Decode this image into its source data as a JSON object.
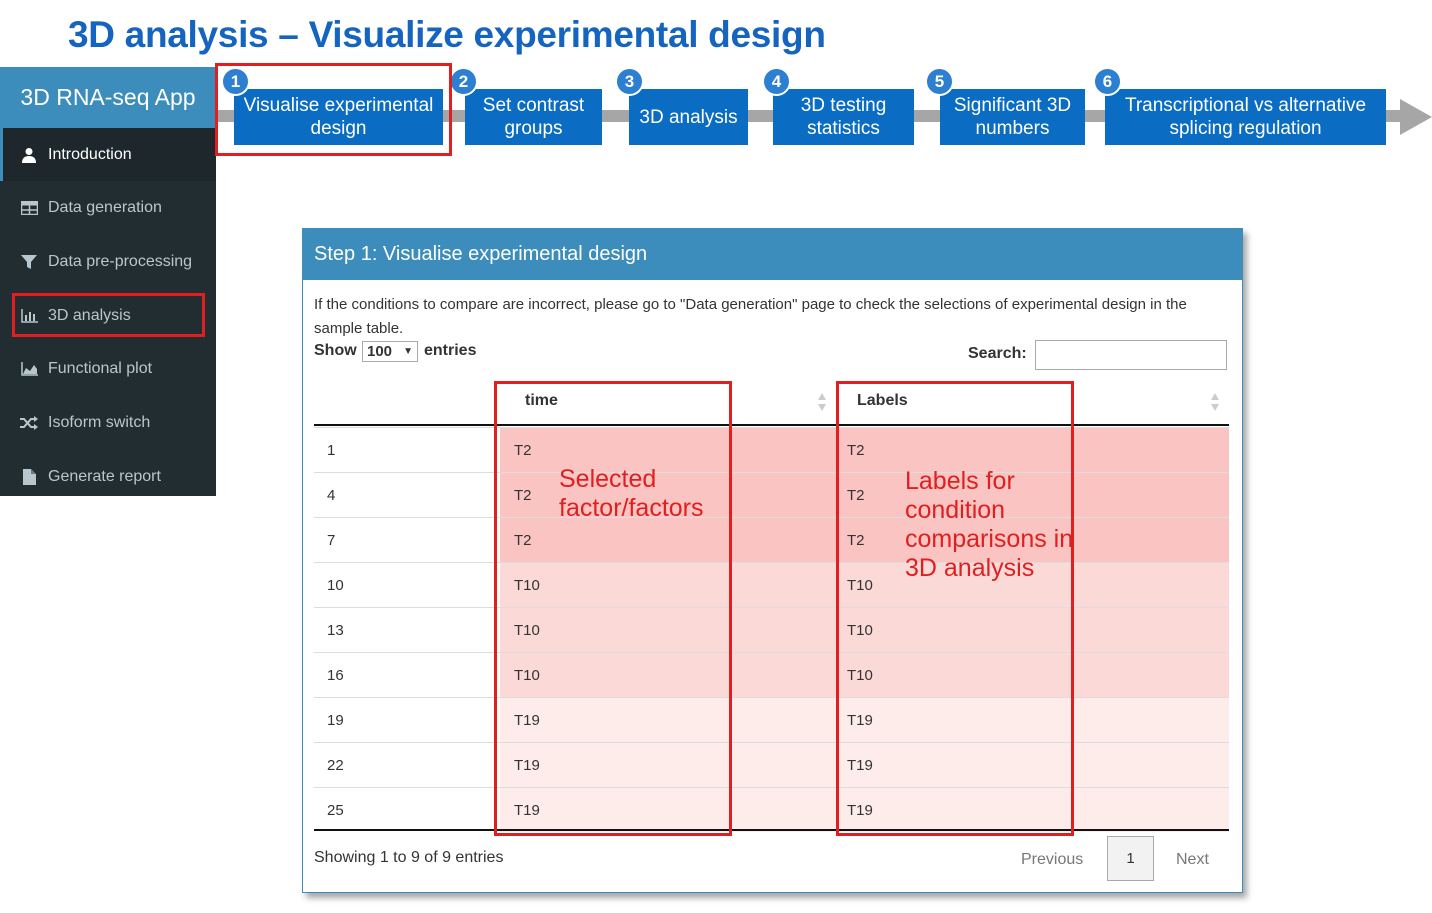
{
  "slide_title": "3D analysis – Visualize experimental design",
  "app": {
    "title": "3D RNA-seq App"
  },
  "sidebar": {
    "items": [
      {
        "label": "Introduction",
        "icon": "user-icon"
      },
      {
        "label": "Data generation",
        "icon": "table-icon"
      },
      {
        "label": "Data pre-processing",
        "icon": "filter-icon"
      },
      {
        "label": "3D analysis",
        "icon": "bar-chart-icon"
      },
      {
        "label": "Functional plot",
        "icon": "area-chart-icon"
      },
      {
        "label": "Isoform switch",
        "icon": "random-icon"
      },
      {
        "label": "Generate report",
        "icon": "file-icon"
      }
    ]
  },
  "steps": [
    {
      "num": "1",
      "label": "Visualise experimental design"
    },
    {
      "num": "2",
      "label": "Set contrast groups"
    },
    {
      "num": "3",
      "label": "3D analysis"
    },
    {
      "num": "4",
      "label": "3D testing statistics"
    },
    {
      "num": "5",
      "label": "Significant 3D numbers"
    },
    {
      "num": "6",
      "label": "Transcriptional vs alternative splicing regulation"
    }
  ],
  "panel": {
    "title": "Step 1: Visualise experimental design",
    "note": "If the conditions to compare are incorrect, please go to \"Data generation\" page to check the selections of experimental design in the sample table.",
    "show_label": "Show",
    "show_value": "100",
    "entries_label": "entries",
    "search_label": "Search:",
    "search_value": ""
  },
  "table": {
    "columns": [
      "",
      "time",
      "Labels"
    ],
    "rows": [
      {
        "id": "1",
        "time": "T2",
        "label": "T2"
      },
      {
        "id": "4",
        "time": "T2",
        "label": "T2"
      },
      {
        "id": "7",
        "time": "T2",
        "label": "T2"
      },
      {
        "id": "10",
        "time": "T10",
        "label": "T10"
      },
      {
        "id": "13",
        "time": "T10",
        "label": "T10"
      },
      {
        "id": "16",
        "time": "T10",
        "label": "T10"
      },
      {
        "id": "19",
        "time": "T19",
        "label": "T19"
      },
      {
        "id": "22",
        "time": "T19",
        "label": "T19"
      },
      {
        "id": "25",
        "time": "T19",
        "label": "T19"
      }
    ],
    "group_colors": {
      "T2": "#f9c4c1",
      "T10": "#fbd9d7",
      "T19": "#fdecea"
    }
  },
  "footer": {
    "info": "Showing 1 to 9 of 9 entries",
    "previous": "Previous",
    "page": "1",
    "next": "Next"
  },
  "annotations": {
    "selected_factors": "Selected factor/factors",
    "labels_note": "Labels for condition comparisons in 3D analysis"
  },
  "colors": {
    "accent": "#3c8dbc",
    "step_blue": "#0a6cc2",
    "highlight_red": "#e02020",
    "sidebar_bg": "#222d32"
  }
}
